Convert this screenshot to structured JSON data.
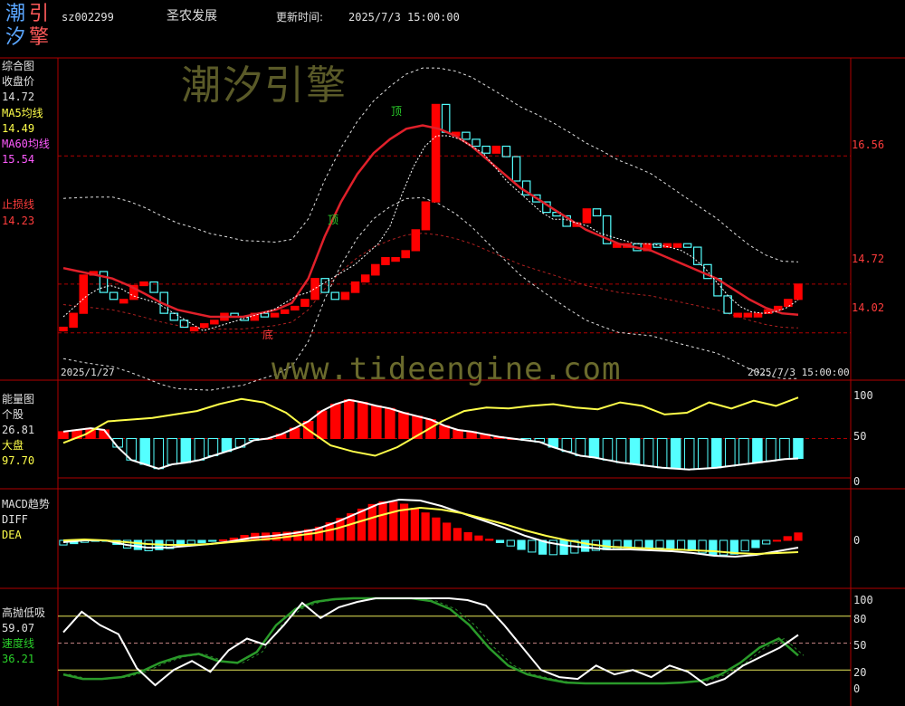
{
  "header": {
    "logo_chars": [
      "潮",
      "引",
      "汐",
      "擎"
    ],
    "code": "sz002299",
    "name": "圣农发展",
    "update_label": "更新时间:",
    "update_time": "2025/7/3 15:00:00"
  },
  "watermark": {
    "cn": "潮汐引擎",
    "url": "www.tideengine.com"
  },
  "panel1": {
    "title": "综合图",
    "close_label": "收盘价",
    "close_value": "14.72",
    "ma5_label": "MA5均线",
    "ma5_value": "14.49",
    "ma60_label": "MA60均线",
    "ma60_value": "15.54",
    "stop_label": "止损线",
    "stop_value": "14.23",
    "date_start": "2025/1/27",
    "date_end": "2025/7/3 15:00:00",
    "price_ticks": [
      "16.56",
      "14.72",
      "14.02"
    ],
    "mark_top": "顶",
    "mark_bottom": "底"
  },
  "panel2": {
    "title": "能量图",
    "stock_label": "个股",
    "stock_value": "26.81",
    "market_label": "大盘",
    "market_value": "97.70",
    "ticks": [
      "100",
      "50",
      "0"
    ]
  },
  "panel3": {
    "title": "MACD趋势",
    "diff_label": "DIFF",
    "dea_label": "DEA",
    "ticks": [
      "0"
    ]
  },
  "panel4": {
    "title": "高抛低吸",
    "value": "59.07",
    "speed_label": "速度线",
    "speed_value": "36.21",
    "ticks": [
      "100",
      "80",
      "50",
      "20",
      "0"
    ]
  },
  "colors": {
    "up": "#ff0000",
    "down": "#54ffff",
    "ma5": "#ffffff",
    "ma60": "#e0202a",
    "stop": "#ff3c3c",
    "yellow": "#ffff4a",
    "green": "#2a9a2a",
    "grid": "#b00000"
  },
  "chart_data": [
    {
      "type": "candlestick",
      "title": "综合图",
      "x": [
        "2025/1/27",
        "2025/7/3"
      ],
      "ylim": [
        13.6,
        17.5
      ],
      "y_ticks": [
        16.56,
        14.72,
        14.02
      ],
      "close": [
        14.1,
        14.3,
        14.85,
        14.9,
        14.6,
        14.5,
        14.5,
        14.7,
        14.75,
        14.6,
        14.3,
        14.2,
        14.1,
        14.1,
        14.15,
        14.2,
        14.3,
        14.25,
        14.2,
        14.3,
        14.25,
        14.3,
        14.35,
        14.4,
        14.5,
        14.8,
        14.6,
        14.5,
        14.6,
        14.75,
        14.85,
        15.0,
        15.1,
        15.1,
        15.2,
        15.5,
        15.9,
        17.3,
        16.9,
        16.9,
        16.8,
        16.7,
        16.6,
        16.7,
        16.55,
        16.2,
        16.0,
        15.9,
        15.75,
        15.7,
        15.55,
        15.6,
        15.8,
        15.7,
        15.3,
        15.3,
        15.3,
        15.2,
        15.3,
        15.25,
        15.3,
        15.3,
        15.25,
        15.0,
        14.8,
        14.55,
        14.3,
        14.3,
        14.3,
        14.3,
        14.35,
        14.4,
        14.5,
        14.72
      ],
      "ma5": [
        14.25,
        14.4,
        14.55,
        14.65,
        14.7,
        14.65,
        14.55,
        14.5,
        14.45,
        14.35,
        14.25,
        14.15,
        14.05,
        14.1,
        14.15,
        14.2,
        14.25,
        14.3,
        14.35,
        14.45,
        14.55,
        14.6,
        14.7,
        14.8,
        14.9,
        15.0,
        15.15,
        15.3,
        15.55,
        16.0,
        16.4,
        16.7,
        16.85,
        16.85,
        16.8,
        16.7,
        16.6,
        16.4,
        16.2,
        16.05,
        15.9,
        15.75,
        15.65,
        15.65,
        15.6,
        15.55,
        15.45,
        15.4,
        15.35,
        15.3,
        15.3,
        15.28,
        15.25,
        15.2,
        15.1,
        14.95,
        14.75,
        14.55,
        14.4,
        14.32,
        14.3,
        14.32,
        14.38,
        14.49
      ],
      "ma60": [
        14.95,
        14.9,
        14.85,
        14.8,
        14.7,
        14.58,
        14.45,
        14.35,
        14.3,
        14.25,
        14.25,
        14.25,
        14.3,
        14.35,
        14.45,
        14.8,
        15.4,
        15.9,
        16.3,
        16.6,
        16.8,
        16.95,
        17.0,
        16.95,
        16.85,
        16.7,
        16.5,
        16.3,
        16.1,
        15.95,
        15.8,
        15.65,
        15.5,
        15.4,
        15.3,
        15.25,
        15.2,
        15.1,
        15.0,
        14.9,
        14.8,
        14.65,
        14.5,
        14.38,
        14.3,
        14.28
      ]
    },
    {
      "type": "bar",
      "title": "能量图",
      "ylim": [
        0,
        100
      ],
      "series": [
        {
          "name": "个股",
          "values": [
            58,
            60,
            62,
            60,
            40,
            25,
            20,
            15,
            20,
            22,
            25,
            30,
            35,
            40,
            48,
            50,
            55,
            62,
            70,
            82,
            90,
            95,
            92,
            88,
            85,
            80,
            76,
            72,
            65,
            60,
            58,
            55,
            52,
            50,
            48,
            46,
            40,
            35,
            30,
            28,
            25,
            22,
            20,
            18,
            16,
            15,
            14,
            15,
            16,
            18,
            20,
            22,
            24,
            26,
            26.81
          ]
        },
        {
          "name": "大盘",
          "values": [
            45,
            55,
            70,
            72,
            74,
            78,
            82,
            90,
            96,
            92,
            80,
            60,
            42,
            35,
            30,
            40,
            55,
            70,
            82,
            86,
            85,
            88,
            90,
            86,
            84,
            92,
            88,
            78,
            80,
            92,
            85,
            94,
            88,
            97.7
          ]
        }
      ]
    },
    {
      "type": "line",
      "title": "MACD趋势",
      "series": [
        {
          "name": "DIFF",
          "values": [
            -0.02,
            0.0,
            0.0,
            -0.05,
            -0.08,
            -0.08,
            -0.06,
            -0.04,
            -0.01,
            0.03,
            0.05,
            0.08,
            0.12,
            0.2,
            0.3,
            0.4,
            0.45,
            0.44,
            0.38,
            0.3,
            0.22,
            0.14,
            0.05,
            -0.02,
            -0.06,
            -0.08,
            -0.1,
            -0.1,
            -0.11,
            -0.12,
            -0.14,
            -0.17,
            -0.18,
            -0.16,
            -0.12,
            -0.08
          ]
        },
        {
          "name": "DEA",
          "values": [
            0.0,
            0.01,
            0.0,
            -0.02,
            -0.04,
            -0.05,
            -0.05,
            -0.04,
            -0.02,
            0.0,
            0.02,
            0.05,
            0.08,
            0.13,
            0.2,
            0.27,
            0.33,
            0.36,
            0.34,
            0.3,
            0.24,
            0.18,
            0.11,
            0.05,
            0.0,
            -0.04,
            -0.07,
            -0.08,
            -0.09,
            -0.1,
            -0.11,
            -0.12,
            -0.14,
            -0.15,
            -0.14,
            -0.13
          ]
        }
      ]
    },
    {
      "type": "line",
      "title": "高抛低吸",
      "ylim": [
        0,
        100
      ],
      "y_ticks": [
        100,
        80,
        50,
        20,
        0
      ],
      "series": [
        {
          "name": "高抛低吸",
          "values": [
            62,
            85,
            70,
            60,
            22,
            3,
            20,
            30,
            18,
            42,
            55,
            48,
            70,
            95,
            78,
            90,
            96,
            100,
            100,
            100,
            100,
            100,
            98,
            92,
            70,
            45,
            20,
            12,
            10,
            25,
            15,
            20,
            12,
            25,
            18,
            3,
            10,
            25,
            35,
            45,
            59.07
          ]
        },
        {
          "name": "速度线",
          "values": [
            15,
            10,
            10,
            12,
            18,
            28,
            35,
            38,
            30,
            28,
            40,
            70,
            88,
            96,
            99,
            100,
            100,
            100,
            100,
            97,
            88,
            70,
            45,
            25,
            15,
            10,
            6,
            5,
            5,
            5,
            5,
            5,
            6,
            8,
            15,
            28,
            45,
            55,
            36.21
          ]
        }
      ]
    }
  ]
}
